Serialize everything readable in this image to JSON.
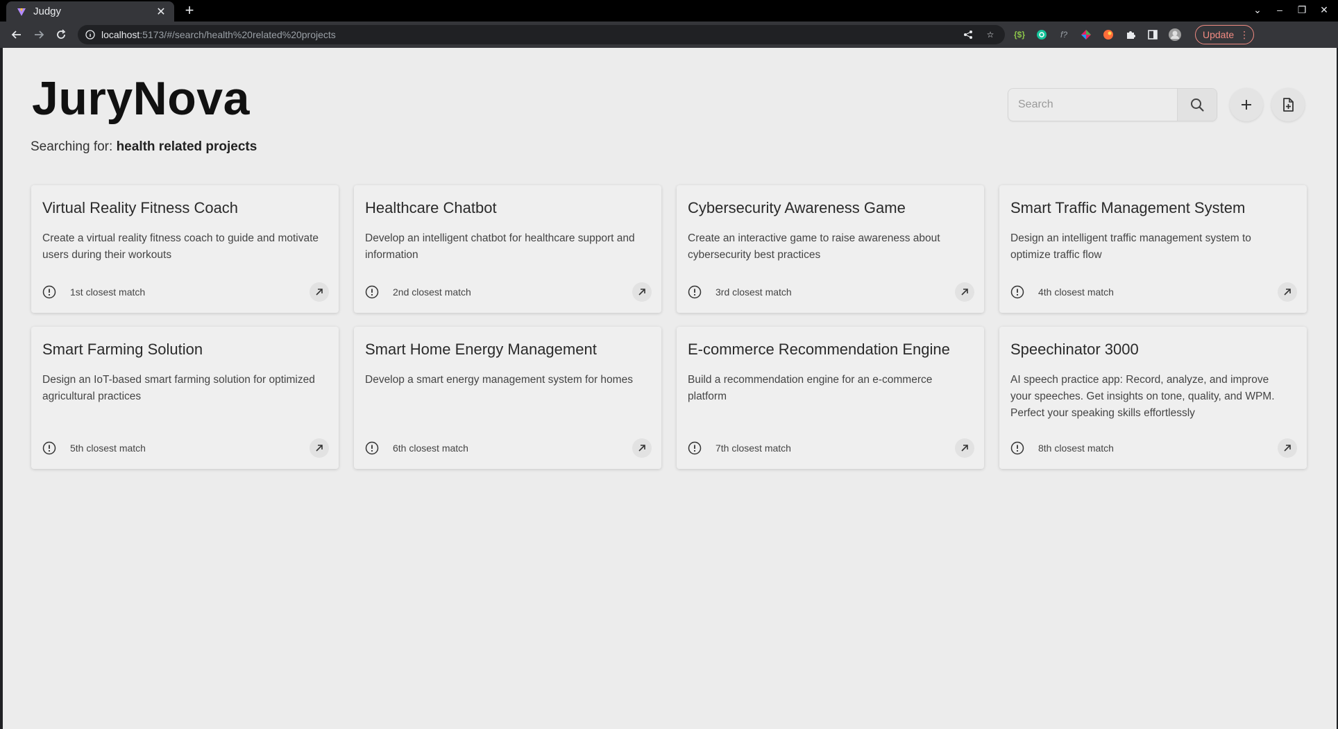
{
  "browser": {
    "tab_title": "Judgy",
    "url_host": "localhost",
    "url_path": ":5173/#/search/health%20related%20projects",
    "update_label": "Update"
  },
  "app": {
    "brand": "JuryNova",
    "searching_prefix": "Searching for: ",
    "query": "health related projects",
    "search_placeholder": "Search"
  },
  "projects": [
    {
      "title": "Virtual Reality Fitness Coach",
      "description": "Create a virtual reality fitness coach to guide and motivate users during their workouts",
      "rank": "1st closest match"
    },
    {
      "title": "Healthcare Chatbot",
      "description": "Develop an intelligent chatbot for healthcare support and information",
      "rank": "2nd closest match"
    },
    {
      "title": "Cybersecurity Awareness Game",
      "description": "Create an interactive game to raise awareness about cybersecurity best practices",
      "rank": "3rd closest match"
    },
    {
      "title": "Smart Traffic Management System",
      "description": "Design an intelligent traffic management system to optimize traffic flow",
      "rank": "4th closest match"
    },
    {
      "title": "Smart Farming Solution",
      "description": "Design an IoT-based smart farming solution for optimized agricultural practices",
      "rank": "5th closest match"
    },
    {
      "title": "Smart Home Energy Management",
      "description": "Develop a smart energy management system for homes",
      "rank": "6th closest match"
    },
    {
      "title": "E-commerce Recommendation Engine",
      "description": "Build a recommendation engine for an e-commerce platform",
      "rank": "7th closest match"
    },
    {
      "title": "Speechinator 3000",
      "description": "AI speech practice app: Record, analyze, and improve your speeches. Get insights on tone, quality, and WPM. Perfect your speaking skills effortlessly",
      "rank": "8th closest match"
    }
  ]
}
